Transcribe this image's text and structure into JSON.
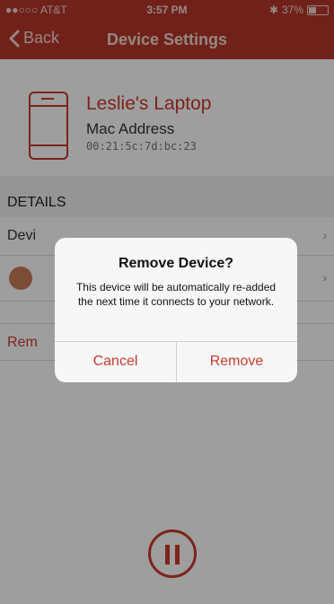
{
  "status_bar": {
    "carrier": "●●○○○ AT&T",
    "time": "3:57 PM",
    "battery": "37%",
    "battery_level": 0.37
  },
  "nav": {
    "back_label": "Back",
    "title": "Device Settings"
  },
  "device": {
    "name": "Leslie's Laptop",
    "mac_label": "Mac Address",
    "mac_value": "00:21:5c:7d:bc:23"
  },
  "details": {
    "header": "DETAILS",
    "row1_label": "Devi",
    "row3_label": "Rem"
  },
  "alert": {
    "title": "Remove Device?",
    "message": "This device will be automatically re-added the next time it connects to your network.",
    "cancel_label": "Cancel",
    "remove_label": "Remove"
  },
  "colors": {
    "accent": "#c83b2c",
    "navbar": "#b5382a"
  }
}
